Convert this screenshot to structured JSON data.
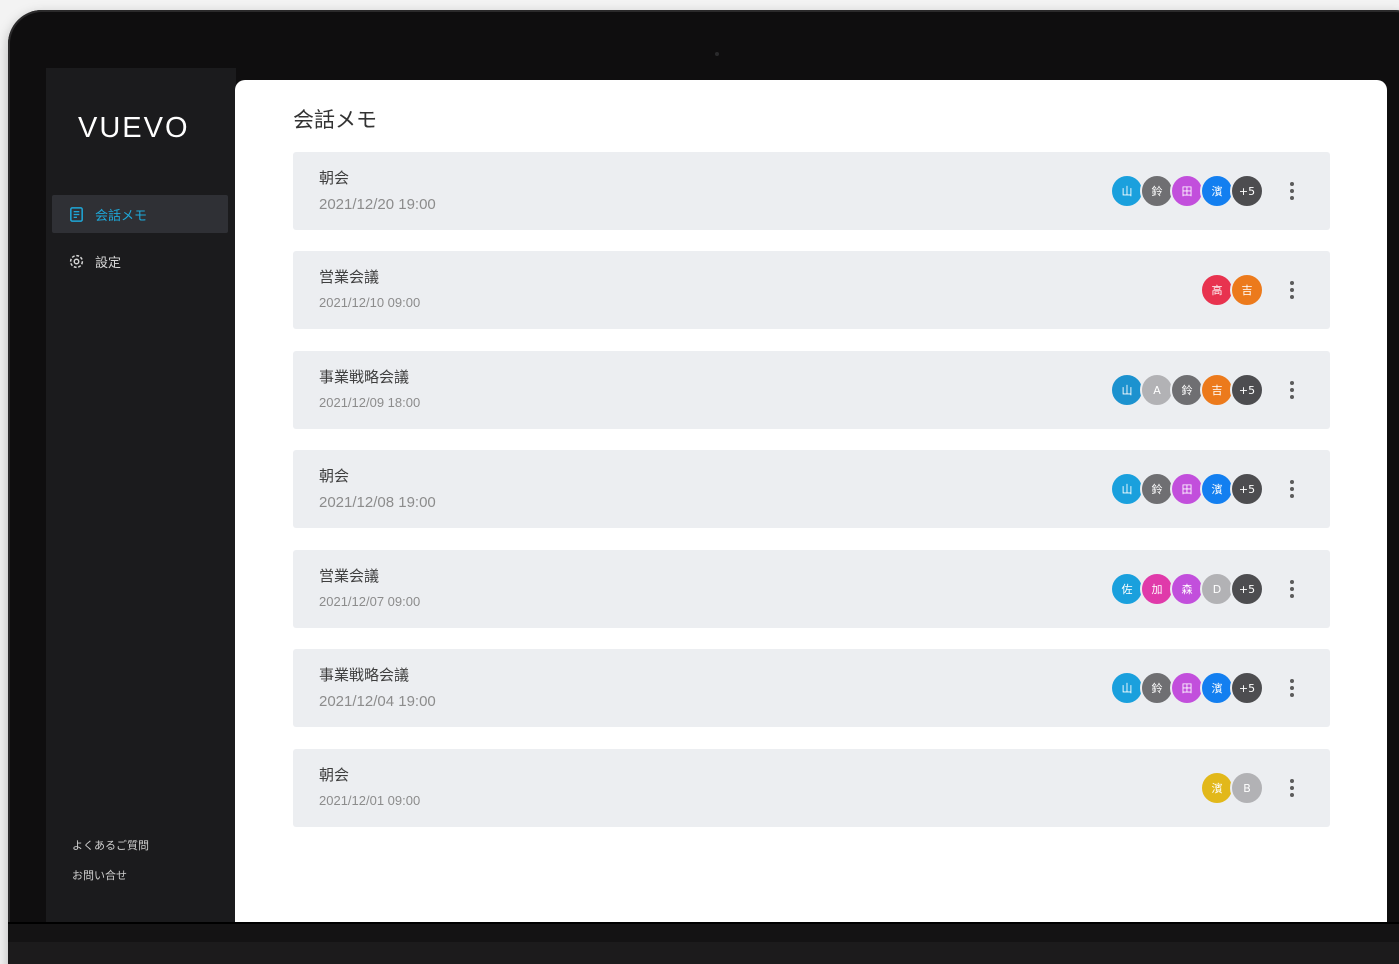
{
  "app": {
    "logo": "VUEVO"
  },
  "sidebar": {
    "items": [
      {
        "label": "会話メモ",
        "icon": "memo-icon",
        "active": true
      },
      {
        "label": "設定",
        "icon": "gear-icon",
        "active": false
      }
    ],
    "footer": [
      "よくあるご質問",
      "お問い合せ"
    ]
  },
  "main": {
    "title": "会話メモ",
    "rows": [
      {
        "title": "朝会",
        "date": "2021/12/20 19:00",
        "avatars": [
          {
            "text": "山",
            "color": "#1aa0dd"
          },
          {
            "text": "鈴",
            "color": "#6f6f72"
          },
          {
            "text": "田",
            "color": "#c24fdc"
          },
          {
            "text": "濱",
            "color": "#137ff0"
          },
          {
            "text": "+5",
            "color": "#4d4d50"
          }
        ]
      },
      {
        "title": "営業会議",
        "date": "2021/12/10 09:00",
        "avatars": [
          {
            "text": "高",
            "color": "#e8334f"
          },
          {
            "text": "吉",
            "color": "#ec7a1c"
          }
        ]
      },
      {
        "title": "事業戦略会議",
        "date": "2021/12/09 18:00",
        "avatars": [
          {
            "text": "山",
            "color": "#1c92cf"
          },
          {
            "text": "A",
            "color": "#b2b2b5"
          },
          {
            "text": "鈴",
            "color": "#6f6f72"
          },
          {
            "text": "吉",
            "color": "#ec7a1c"
          },
          {
            "text": "+5",
            "color": "#4d4d50"
          }
        ]
      },
      {
        "title": "朝会",
        "date": "2021/12/08 19:00",
        "avatars": [
          {
            "text": "山",
            "color": "#1aa0dd"
          },
          {
            "text": "鈴",
            "color": "#6f6f72"
          },
          {
            "text": "田",
            "color": "#c24fdc"
          },
          {
            "text": "濱",
            "color": "#137ff0"
          },
          {
            "text": "+5",
            "color": "#4d4d50"
          }
        ]
      },
      {
        "title": "営業会議",
        "date": "2021/12/07 09:00",
        "avatars": [
          {
            "text": "佐",
            "color": "#1aa0dd"
          },
          {
            "text": "加",
            "color": "#e03aaa"
          },
          {
            "text": "森",
            "color": "#c24fdc"
          },
          {
            "text": "D",
            "color": "#b2b2b5"
          },
          {
            "text": "+5",
            "color": "#4d4d50"
          }
        ]
      },
      {
        "title": "事業戦略会議",
        "date": "2021/12/04 19:00",
        "avatars": [
          {
            "text": "山",
            "color": "#1aa0dd"
          },
          {
            "text": "鈴",
            "color": "#6f6f72"
          },
          {
            "text": "田",
            "color": "#c24fdc"
          },
          {
            "text": "濱",
            "color": "#137ff0"
          },
          {
            "text": "+5",
            "color": "#4d4d50"
          }
        ]
      },
      {
        "title": "朝会",
        "date": "2021/12/01 09:00",
        "avatars": [
          {
            "text": "濱",
            "color": "#e2b81a"
          },
          {
            "text": "B",
            "color": "#b2b2b5"
          }
        ]
      }
    ]
  },
  "colors": {
    "accent": "#1ea7d8",
    "sidebar_bg": "#1b1b1d",
    "row_bg": "#eceef1"
  }
}
